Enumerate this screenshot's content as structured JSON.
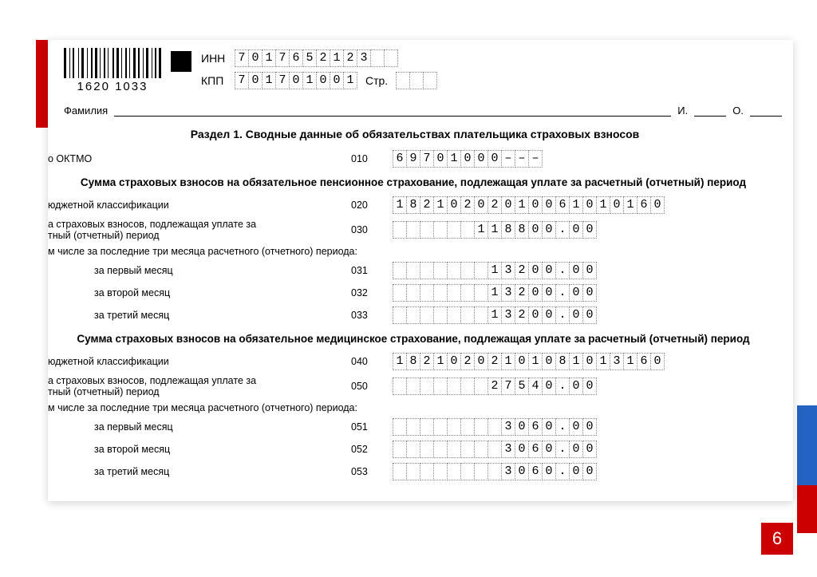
{
  "barcode_number": "1620 1033",
  "ids": {
    "inn_label": "ИНН",
    "inn": [
      "7",
      "0",
      "1",
      "7",
      "6",
      "5",
      "2",
      "1",
      "2",
      "3",
      "",
      ""
    ],
    "kpp_label": "КПП",
    "kpp": [
      "7",
      "0",
      "1",
      "7",
      "0",
      "1",
      "0",
      "0",
      "1"
    ],
    "str_label": "Стр.",
    "str": [
      "",
      "",
      ""
    ]
  },
  "name_row": {
    "surname_label": "Фамилия",
    "i_label": "И.",
    "o_label": "О."
  },
  "section_title": "Раздел 1. Сводные данные об обязательствах плательщика страховых взносов",
  "rows": {
    "oktmo_label": "о ОКТМО",
    "oktmo_code": "010",
    "oktmo_cells": [
      "6",
      "9",
      "7",
      "0",
      "1",
      "0",
      "0",
      "0",
      "–",
      "–",
      "–"
    ],
    "heading_pension": "Сумма страховых взносов на обязательное пенсионное страхование, подлежащая уплате за расчетный (отчетный) период",
    "kbk_label": "юджетной классификации",
    "kbk_code_020": "020",
    "kbk_020_cells": [
      "1",
      "8",
      "2",
      "1",
      "0",
      "2",
      "0",
      "2",
      "0",
      "1",
      "0",
      "0",
      "6",
      "1",
      "0",
      "1",
      "0",
      "1",
      "6",
      "0"
    ],
    "sum_label": "а страховых взносов, подлежащая уплате за\nтный (отчетный) период",
    "sum_code_030": "030",
    "sum_030_cells": [
      "",
      "",
      "",
      "",
      "",
      "",
      "1",
      "1",
      "8",
      "8",
      "0",
      "0",
      ".",
      "0",
      "0"
    ],
    "last3_note": "м числе за последние три месяца расчетного (отчетного) периода:",
    "m1_label": "за первый месяц",
    "m1_code": "031",
    "m1_cells": [
      "",
      "",
      "",
      "",
      "",
      "",
      "",
      "1",
      "3",
      "2",
      "0",
      "0",
      ".",
      "0",
      "0"
    ],
    "m2_label": "за второй месяц",
    "m2_code": "032",
    "m2_cells": [
      "",
      "",
      "",
      "",
      "",
      "",
      "",
      "1",
      "3",
      "2",
      "0",
      "0",
      ".",
      "0",
      "0"
    ],
    "m3_label": "за третий месяц",
    "m3_code": "033",
    "m3_cells": [
      "",
      "",
      "",
      "",
      "",
      "",
      "",
      "1",
      "3",
      "2",
      "0",
      "0",
      ".",
      "0",
      "0"
    ],
    "heading_med": "Сумма страховых взносов на обязательное медицинское страхование, подлежащая уплате за расчетный (отчетный) период",
    "kbk_code_040": "040",
    "kbk_040_cells": [
      "1",
      "8",
      "2",
      "1",
      "0",
      "2",
      "0",
      "2",
      "1",
      "0",
      "1",
      "0",
      "8",
      "1",
      "0",
      "1",
      "3",
      "1",
      "6",
      "0"
    ],
    "sum_code_050": "050",
    "sum_050_cells": [
      "",
      "",
      "",
      "",
      "",
      "",
      "",
      "2",
      "7",
      "5",
      "4",
      "0",
      ".",
      "0",
      "0"
    ],
    "m1_code_051": "051",
    "m1_051_cells": [
      "",
      "",
      "",
      "",
      "",
      "",
      "",
      "",
      "3",
      "0",
      "6",
      "0",
      ".",
      "0",
      "0"
    ],
    "m2_code_052": "052",
    "m2_052_cells": [
      "",
      "",
      "",
      "",
      "",
      "",
      "",
      "",
      "3",
      "0",
      "6",
      "0",
      ".",
      "0",
      "0"
    ],
    "m3_code_053": "053",
    "m3_053_cells": [
      "",
      "",
      "",
      "",
      "",
      "",
      "",
      "",
      "3",
      "0",
      "6",
      "0",
      ".",
      "0",
      "0"
    ]
  },
  "page_number": "6"
}
